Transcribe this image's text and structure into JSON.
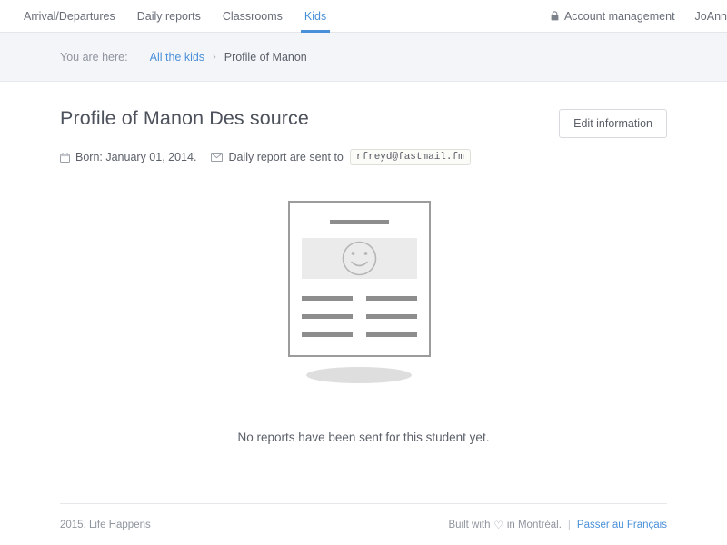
{
  "nav": {
    "items": [
      {
        "label": "Arrival/Departures",
        "active": false
      },
      {
        "label": "Daily reports",
        "active": false
      },
      {
        "label": "Classrooms",
        "active": false
      },
      {
        "label": "Kids",
        "active": true
      }
    ],
    "account_label": "Account management",
    "user_label": "JoAnn",
    "active_color": "#4a90d9"
  },
  "breadcrumb": {
    "prefix": "You are here:",
    "link": "All the kids",
    "separator": "›",
    "current": "Profile of Manon"
  },
  "profile": {
    "title": "Profile of Manon Des source",
    "edit_button": "Edit information",
    "born_label": "Born: January 01, 2014.",
    "report_label": "Daily report are sent to",
    "email": "rfreyd@fastmail.fm"
  },
  "empty_state": {
    "message": "No reports have been sent for this student yet."
  },
  "footer": {
    "copyright": "2015. Life Happens",
    "built_prefix": "Built with",
    "heart": "♡",
    "built_suffix": "in Montréal.",
    "separator": "|",
    "language_link": "Passer au Français"
  }
}
